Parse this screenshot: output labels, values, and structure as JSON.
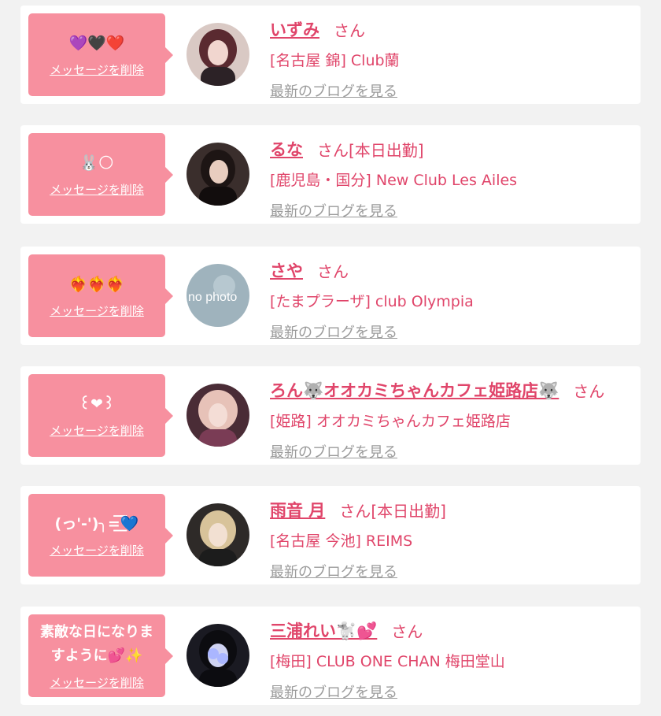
{
  "entries": [
    {
      "message": "💜🖤❤️",
      "delete_label": "メッセージを削除",
      "name": "いずみ",
      "honorific": "さん",
      "status": "",
      "shop": "[名古屋 錦] Club蘭",
      "blog_link": "最新のブログを見る"
    },
    {
      "message": "🐰🌕",
      "delete_label": "メッセージを削除",
      "name": "るな",
      "honorific": "さん",
      "status": "[本日出勤]",
      "shop": "[鹿児島・国分] New Club Les Ailes",
      "blog_link": "最新のブログを見る"
    },
    {
      "message": "❤️‍🔥❤️‍🔥❤️‍🔥",
      "delete_label": "メッセージを削除",
      "name": "さや",
      "honorific": "さん",
      "status": "",
      "shop": "[たまプラーザ] club Olympia",
      "blog_link": "最新のブログを見る",
      "avatar_text": "no photo"
    },
    {
      "message": "꒰❤︎꒱",
      "delete_label": "メッセージを削除",
      "name": "ろん🐺オオカミちゃんカフェ姫路店🐺",
      "honorific": "さん",
      "status": "",
      "shop": "[姫路] オオカミちゃんカフェ姫路店",
      "blog_link": "最新のブログを見る"
    },
    {
      "message": "(っ'-')╮=͟͟͞͞💙",
      "delete_label": "メッセージを削除",
      "name": "雨音 月",
      "honorific": "さん",
      "status": "[本日出勤]",
      "shop": "[名古屋 今池] REIMS",
      "blog_link": "最新のブログを見る"
    },
    {
      "message": "素敵な日になりますように💕✨",
      "delete_label": "メッセージを削除",
      "name": "三浦れい🐩💕",
      "honorific": "さん",
      "status": "",
      "shop": "[梅田] CLUB ONE CHAN 梅田堂山",
      "blog_link": "最新のブログを見る"
    }
  ],
  "colors": {
    "accent": "#e0456a",
    "bubble": "#f7909f",
    "background": "#f2f2f2",
    "link_gray": "#9b9b9b"
  }
}
